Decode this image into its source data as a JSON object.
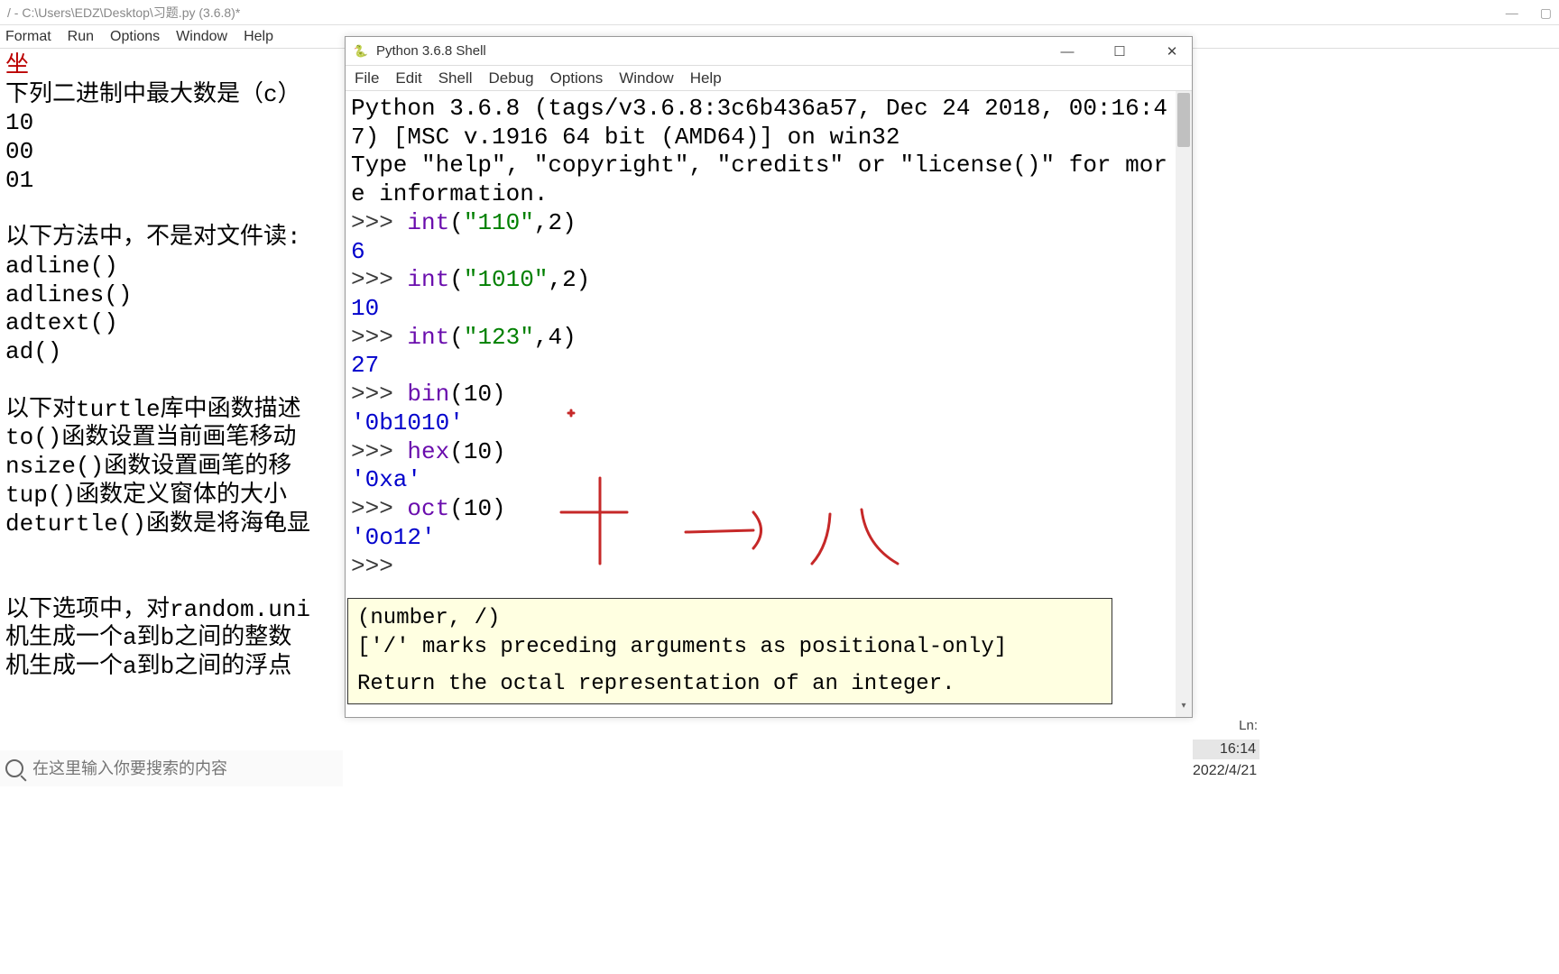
{
  "editor": {
    "title": "/ - C:\\Users\\EDZ\\Desktop\\习题.py (3.6.8)*",
    "menus": [
      "Format",
      "Run",
      "Options",
      "Window",
      "Help"
    ],
    "lines": [
      {
        "t": "坐",
        "cls": "red"
      },
      {
        "t": "下列二进制中最大数是（c）"
      },
      {
        "t": "10"
      },
      {
        "t": "00"
      },
      {
        "t": "01"
      },
      {
        "t": ""
      },
      {
        "t": "以下方法中，不是对文件读:"
      },
      {
        "t": "adline()"
      },
      {
        "t": "adlines()"
      },
      {
        "t": "adtext()"
      },
      {
        "t": "ad()"
      },
      {
        "t": ""
      },
      {
        "t": "以下对turtle库中函数描述"
      },
      {
        "t": "to()函数设置当前画笔移动"
      },
      {
        "t": "nsize()函数设置画笔的移"
      },
      {
        "t": "tup()函数定义窗体的大小"
      },
      {
        "t": "deturtle()函数是将海龟显"
      },
      {
        "t": ""
      },
      {
        "t": ""
      },
      {
        "t": "以下选项中，对random.uni"
      },
      {
        "t": "机生成一个a到b之间的整数"
      },
      {
        "t": "机生成一个a到b之间的浮点"
      }
    ]
  },
  "shell": {
    "title": "Python 3.6.8 Shell",
    "menus": [
      "File",
      "Edit",
      "Shell",
      "Debug",
      "Options",
      "Window",
      "Help"
    ],
    "banner1": "Python 3.6.8 (tags/v3.6.8:3c6b436a57, Dec 24 2018, 00:16:47) [MSC v.1916 64 bit (AMD64)] on win32",
    "banner2": "Type \"help\", \"copyright\", \"credits\" or \"license()\" for more information.",
    "entries": [
      {
        "in": {
          "func": "int",
          "args_pre": "(",
          "str": "\"110\"",
          "args_post": ",2)"
        },
        "out": "6",
        "outcls": "numout"
      },
      {
        "in": {
          "func": "int",
          "args_pre": "(",
          "str": "\"1010\"",
          "args_post": ",2)"
        },
        "out": "10",
        "outcls": "numout"
      },
      {
        "in": {
          "func": "int",
          "args_pre": "(",
          "str": "\"123\"",
          "args_post": ",4)"
        },
        "out": "27",
        "outcls": "numout"
      },
      {
        "in": {
          "func": "bin",
          "args_pre": "(10)",
          "str": "",
          "args_post": ""
        },
        "out": "'0b1010'",
        "outcls": "strout"
      },
      {
        "in": {
          "func": "hex",
          "args_pre": "(10)",
          "str": "",
          "args_post": ""
        },
        "out": "'0xa'",
        "outcls": "strout"
      },
      {
        "in": {
          "func": "oct",
          "args_pre": "(10)",
          "str": "",
          "args_post": ""
        },
        "out": "'0o12'",
        "outcls": "strout"
      }
    ],
    "prompt": ">>> ",
    "tooltip_line1": "(number, /)",
    "tooltip_line2": "['/' marks preceding arguments as positional-only]",
    "tooltip_line3": "Return the octal representation of an integer."
  },
  "status": {
    "ln_label": "Ln:"
  },
  "clock": {
    "time": "16:14",
    "date": "2022/4/21"
  },
  "taskbar": {
    "search_placeholder": "在这里输入你要搜索的内容"
  }
}
